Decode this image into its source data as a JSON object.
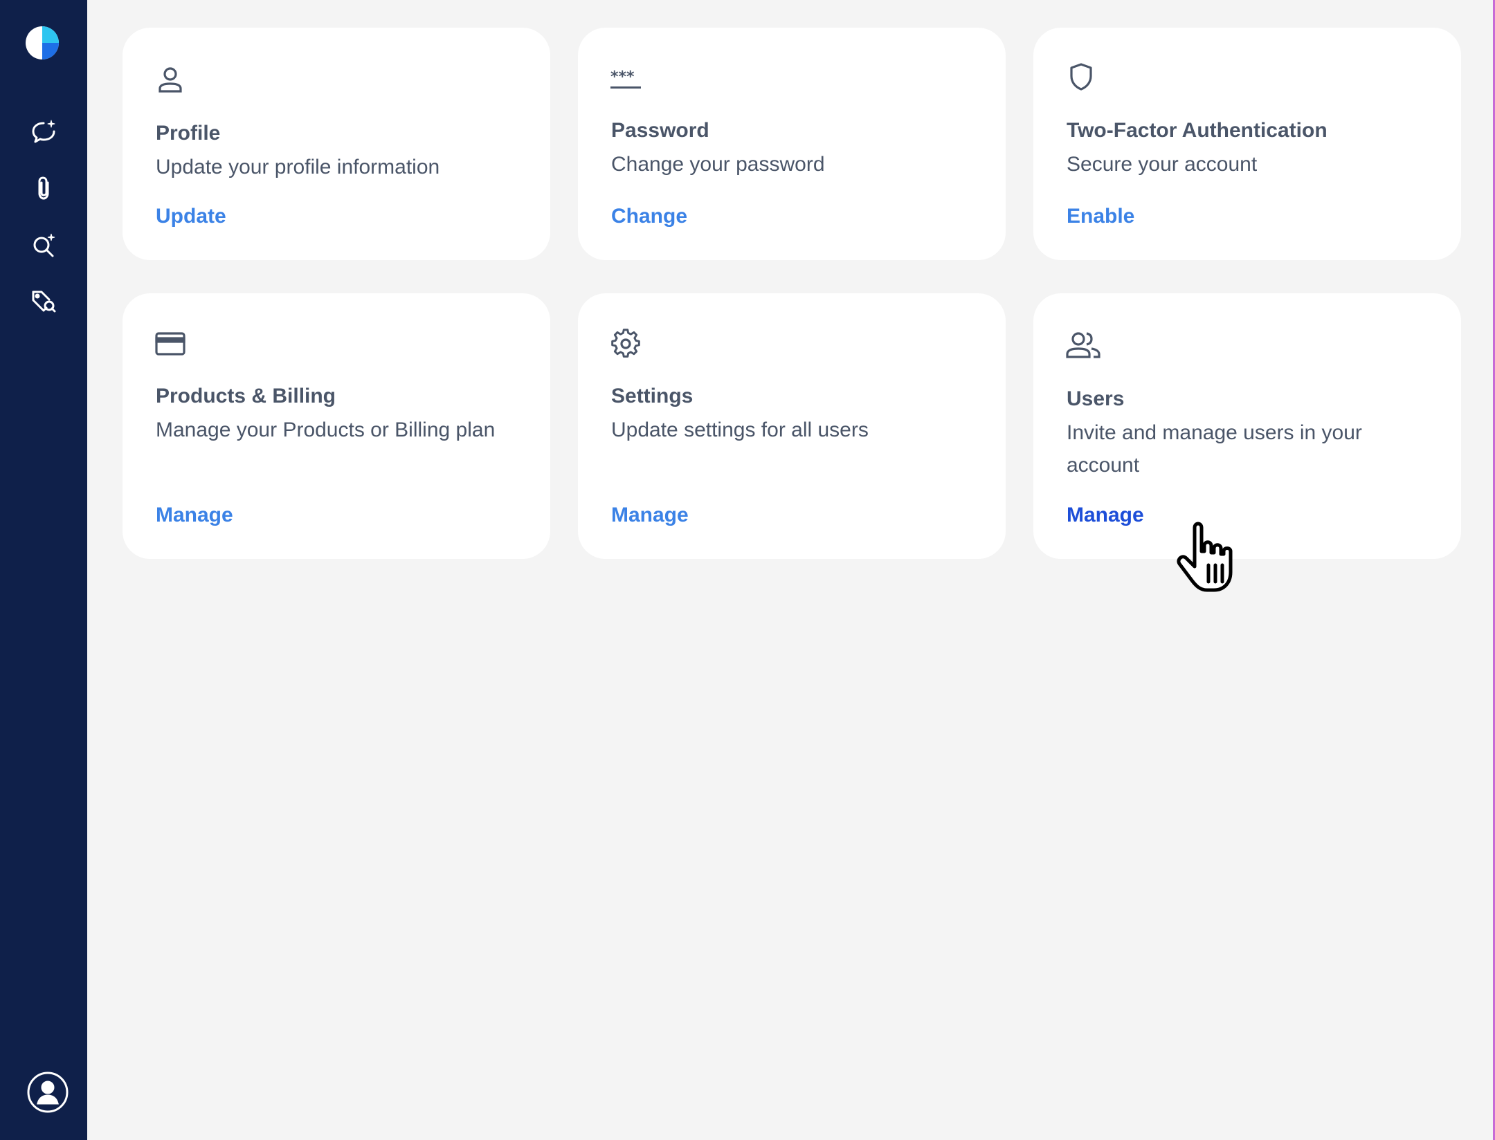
{
  "sidebar": {
    "items": [
      {
        "name": "chat-sparkle",
        "label": ""
      },
      {
        "name": "attachment",
        "label": ""
      },
      {
        "name": "search-sparkle",
        "label": ""
      },
      {
        "name": "tag-search",
        "label": ""
      }
    ]
  },
  "cards": [
    {
      "title": "Profile",
      "description": "Update your profile information",
      "action": "Update",
      "icon": "person-icon"
    },
    {
      "title": "Password",
      "description": "Change your password",
      "action": "Change",
      "icon": "password-icon"
    },
    {
      "title": "Two-Factor Authentication",
      "description": "Secure your account",
      "action": "Enable",
      "icon": "shield-icon"
    },
    {
      "title": "Products & Billing",
      "description": "Manage your Products or Billing plan",
      "action": "Manage",
      "icon": "credit-card-icon"
    },
    {
      "title": "Settings",
      "description": "Update settings for all users",
      "action": "Manage",
      "icon": "gear-icon"
    },
    {
      "title": "Users",
      "description": "Invite and manage users in your account",
      "action": "Manage",
      "icon": "users-icon"
    }
  ],
  "colors": {
    "sidebar_bg": "#0f204a",
    "link": "#3b82e6",
    "link_hover": "#1d4ed8",
    "text": "#4a5568",
    "page_bg": "#f4f4f4"
  }
}
